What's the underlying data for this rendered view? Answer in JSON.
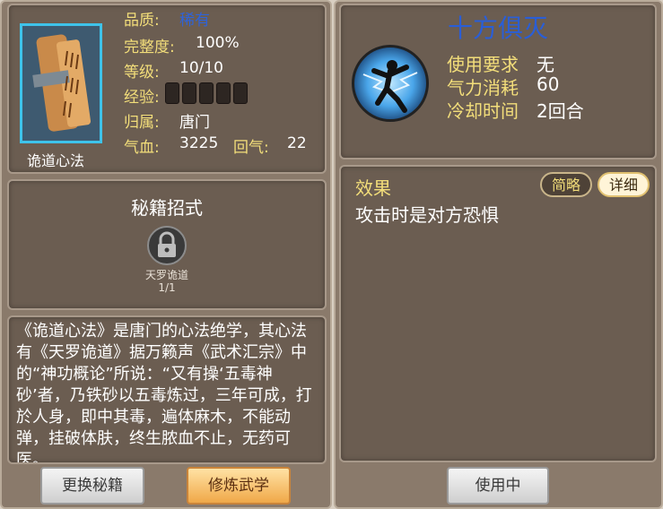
{
  "book": {
    "name": "诡道心法",
    "quality_label": "品质:",
    "quality_value": "稀有",
    "integrity_label": "完整度:",
    "integrity_value": "100%",
    "level_label": "等级:",
    "level_value": "10/10",
    "exp_label": "经验:",
    "exp_slots": 5,
    "belong_label": "归属:",
    "belong_value": "唐门",
    "hp_label": "气血:",
    "hp_value": "3225",
    "qi_label": "回气:",
    "qi_value": "22"
  },
  "moves": {
    "title": "秘籍招式",
    "skill_name": "天罗诡道",
    "skill_count": "1/1"
  },
  "description": "《诡道心法》是唐门的心法绝学，其心法有《天罗诡道》据万籁声《武术汇宗》中的“神功概论”所说：“又有操‘五毒神砂’者，乃铁砂以五毒炼过，三年可成，打於人身，即中其毒，遍体麻木，不能动弹，挂破体肤，终生脓血不止，无药可医。",
  "buttons": {
    "change": "更换秘籍",
    "train": "修炼武学",
    "use": "使用中"
  },
  "skill": {
    "title": "十方俱灭",
    "req_label": "使用要求",
    "req_value": "无",
    "cost_label": "气力消耗",
    "cost_value": "60",
    "cd_label": "冷却时间",
    "cd_value": "2回合"
  },
  "effect": {
    "title": "效果",
    "brief_label": "简略",
    "detail_label": "详细",
    "text": "攻击时是对方恐惧"
  },
  "colors": {
    "label_yellow": "#f3de7a",
    "quality_blue": "#2f63d8",
    "title_blue": "#2a5ed6",
    "panel_brown": "#6b5d51"
  }
}
